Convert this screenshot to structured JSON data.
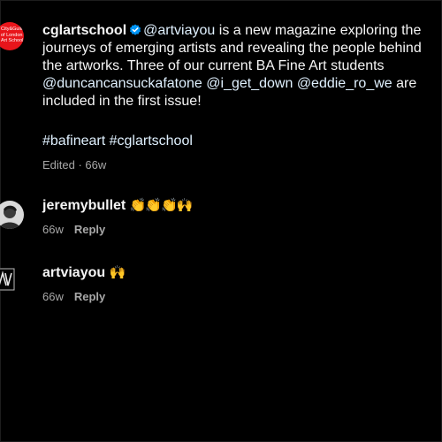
{
  "post": {
    "author": "cglartschool",
    "avatar_text": "CityLitGuilds of London Art School",
    "caption_lines": [
      [
        "@artviayou",
        " is a new magazine exploring the"
      ],
      [
        "journeys of emerging artists and revealing the people behind"
      ],
      [
        "the artworks. Three of our current BA Fine Art students"
      ],
      [
        "@duncancansuckafatone",
        " ",
        "@i_get_down",
        " ",
        "@eddie_ro_we",
        " are"
      ],
      [
        "included in the first issue!"
      ]
    ],
    "line0_mention": "@artviayou",
    "line0_rest": " is a new magazine exploring the",
    "line1": "journeys of emerging artists and revealing the people behind",
    "line2": "the artworks. Three of our current BA Fine Art students",
    "line3_mention1": "@duncancansuckafatone",
    "line3_mention2": "@i_get_down",
    "line3_mention3": "@eddie_ro_we",
    "line3_rest": " are",
    "line4": "included in the first issue!",
    "hashtag1": "#bafineart",
    "hashtag2": "#cglartschool",
    "meta": "Edited · 66w"
  },
  "comments": [
    {
      "author": "jeremybullet",
      "emoji": "👏👏👏🙌",
      "time": "66w",
      "reply_label": "Reply"
    },
    {
      "author": "artviayou",
      "emoji": "🙌",
      "time": "66w",
      "reply_label": "Reply"
    }
  ],
  "colors": {
    "background": "#000000",
    "text": "#f5f5f5",
    "secondary": "#a8a8a8",
    "link": "#e0f1ff",
    "verified": "#0095f6",
    "avatar_main": "#e8151b"
  }
}
